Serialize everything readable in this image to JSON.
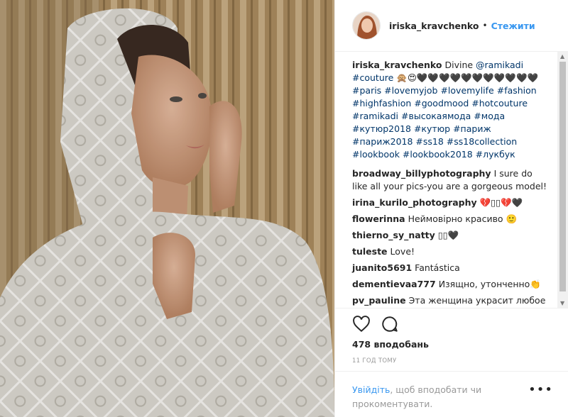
{
  "post": {
    "username": "iriska_kravchenko",
    "follow_label": "Стежити",
    "separator": "•"
  },
  "caption": {
    "user": "iriska_kravchenko",
    "text_1": "Divine ",
    "mention": "@ramikadi",
    "tag_couture": "#couture",
    "emoji": " 🙊😍🖤🖤🖤🖤🖤🖤🖤🖤🖤🖤🖤",
    "tags": "#paris #lovemyjob #lovemylife #fashion #highfashion #goodmood #hotcouture #ramikadi #высокаямода #мода #кутюр2018 #кутюр #париж #париж2018 #ss18 #ss18collection #lookbook #lookbook2018 #лукбук"
  },
  "comments": [
    {
      "user": "broadway_billyphotography",
      "text": "I sure do like all your pics-you are a gorgeous model!"
    },
    {
      "user": "irina_kurilo_photography",
      "text": "💔▯▯💔🖤"
    },
    {
      "user": "flowerinna",
      "text": "Неймовірно красиво 🙂"
    },
    {
      "user": "thierno_sy_natty",
      "text": "▯▯🖤"
    },
    {
      "user": "tuleste",
      "text": "Love!"
    },
    {
      "user": "juanito5691",
      "text": "Fantástica"
    },
    {
      "user": "dementievaa777",
      "text": "Изящно, утонченно👏"
    },
    {
      "user": "pv_pauline",
      "text": "Эта женщина украсит любое"
    }
  ],
  "actions": {
    "like_icon": "heart-icon",
    "comment_icon": "comment-bubble-icon"
  },
  "likes_text": "478 вподобань",
  "time_text": "11 ГОД ТОМУ",
  "login": {
    "link": "Увійдіть",
    "rest": ", щоб вподобати чи прокоментувати.",
    "more": "•••"
  },
  "colors": {
    "link": "#3897f0",
    "hashtag": "#003569",
    "text": "#262626",
    "muted": "#999999"
  }
}
